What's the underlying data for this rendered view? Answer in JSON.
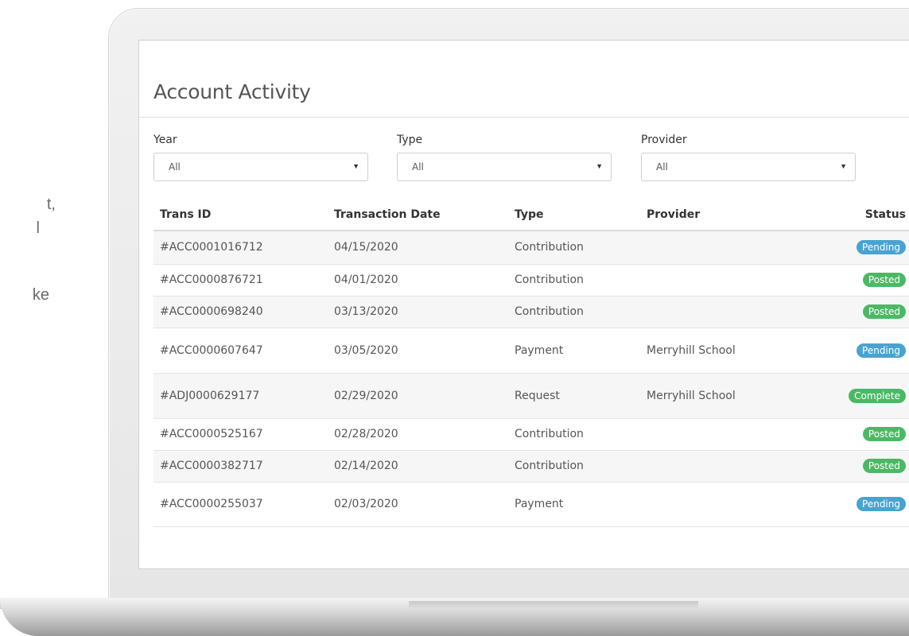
{
  "side_text": {
    "line1": "t,",
    "line2": "l",
    "line3": "ke"
  },
  "page": {
    "title": "Account Activity"
  },
  "filters": [
    {
      "label": "Year",
      "value": "All"
    },
    {
      "label": "Type",
      "value": "All"
    },
    {
      "label": "Provider",
      "value": "All"
    }
  ],
  "table": {
    "headers": {
      "trans_id": "Trans ID",
      "date": "Transaction Date",
      "type": "Type",
      "provider": "Provider",
      "status": "Status"
    },
    "rows": [
      {
        "id": "#ACC0001016712",
        "date": "04/15/2020",
        "type": "Contribution",
        "provider": "",
        "status": "Pending"
      },
      {
        "id": "#ACC0000876721",
        "date": "04/01/2020",
        "type": "Contribution",
        "provider": "",
        "status": "Posted"
      },
      {
        "id": "#ACC0000698240",
        "date": "03/13/2020",
        "type": "Contribution",
        "provider": "",
        "status": "Posted"
      },
      {
        "id": "#ACC0000607647",
        "date": "03/05/2020",
        "type": "Payment",
        "provider": "Merryhill School",
        "status": "Pending"
      },
      {
        "id": "#ADJ0000629177",
        "date": "02/29/2020",
        "type": "Request",
        "provider": "Merryhill School",
        "status": "Complete"
      },
      {
        "id": "#ACC0000525167",
        "date": "02/28/2020",
        "type": "Contribution",
        "provider": "",
        "status": "Posted"
      },
      {
        "id": "#ACC0000382717",
        "date": "02/14/2020",
        "type": "Contribution",
        "provider": "",
        "status": "Posted"
      },
      {
        "id": "#ACC0000255037",
        "date": "02/03/2020",
        "type": "Payment",
        "provider": "",
        "status": "Pending"
      }
    ]
  },
  "status_colors": {
    "Pending": "#4aa3cf",
    "Posted": "#4cb866",
    "Complete": "#4cb866"
  }
}
